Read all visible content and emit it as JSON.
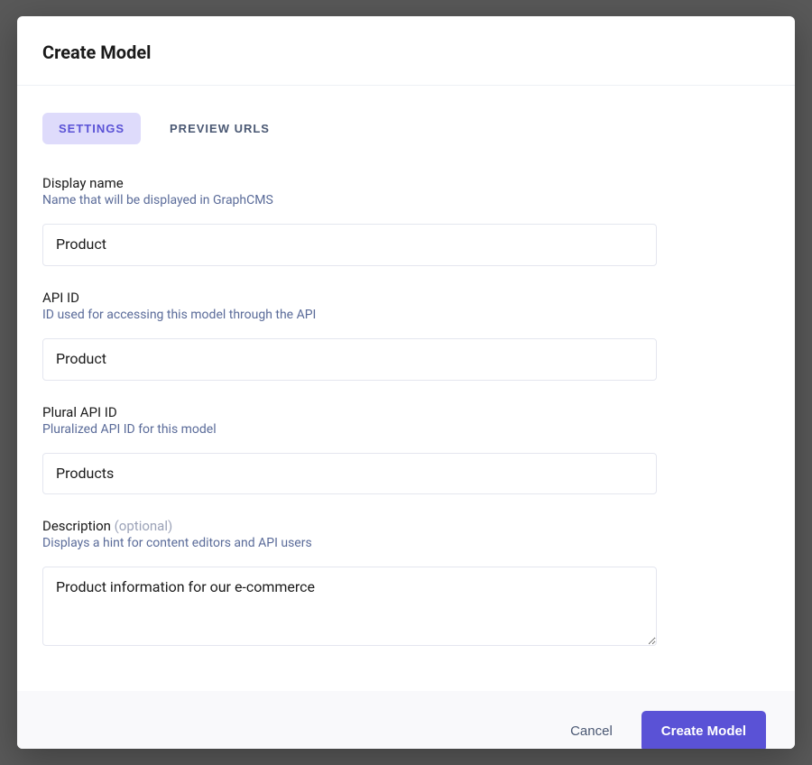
{
  "header": {
    "title": "Create Model"
  },
  "tabs": {
    "settings": "SETTINGS",
    "preview_urls": "PREVIEW URLS"
  },
  "fields": {
    "display_name": {
      "label": "Display name",
      "hint": "Name that will be displayed in GraphCMS",
      "value": "Product"
    },
    "api_id": {
      "label": "API ID",
      "hint": "ID used for accessing this model through the API",
      "value": "Product"
    },
    "plural_api_id": {
      "label": "Plural API ID",
      "hint": "Pluralized API ID for this model",
      "value": "Products"
    },
    "description": {
      "label": "Description",
      "optional_text": "(optional)",
      "hint": "Displays a hint for content editors and API users",
      "value": "Product information for our e-commerce"
    }
  },
  "footer": {
    "cancel_label": "Cancel",
    "submit_label": "Create Model"
  }
}
